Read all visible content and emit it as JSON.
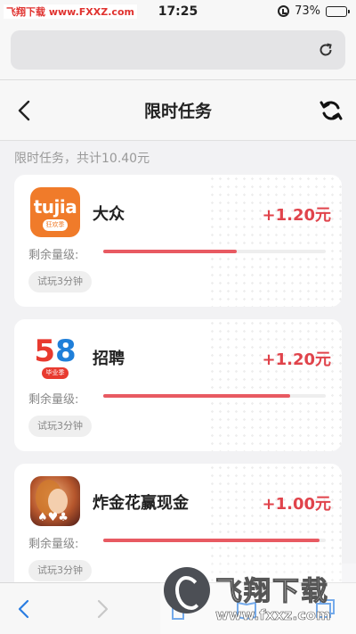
{
  "status_bar": {
    "watermark": "飞翔下载 www.FXXZ.com",
    "time": "17:25",
    "battery": "73%"
  },
  "nav": {
    "title": "限时任务"
  },
  "summary": "限时任务，共计10.40元",
  "tasks": [
    {
      "logo": "tujia-logo",
      "logo_text": "tujia",
      "logo_sub": "狂欢季",
      "name": "大众",
      "reward": "+1.20元",
      "quantity_label": "剩余量级:",
      "remaining": 0.6,
      "tag": "试玩3分钟"
    },
    {
      "logo": "58-logo",
      "logo_text": "58",
      "logo_sub": "毕业季",
      "name": "招聘",
      "reward": "+1.20元",
      "quantity_label": "剩余量级:",
      "remaining": 0.84,
      "tag": "试玩3分钟"
    },
    {
      "logo": "game-logo",
      "name": "炸金花赢现金",
      "reward": "+1.00元",
      "quantity_label": "剩余量级:",
      "remaining": 0.97,
      "tag": "试玩3分钟"
    }
  ],
  "watermark_bottom": {
    "text": "飞翔下载",
    "url": "www.fxxz.com"
  },
  "colors": {
    "accent": "#e0434b",
    "bar": "#e85a62",
    "tujia": "#f07b2a"
  }
}
